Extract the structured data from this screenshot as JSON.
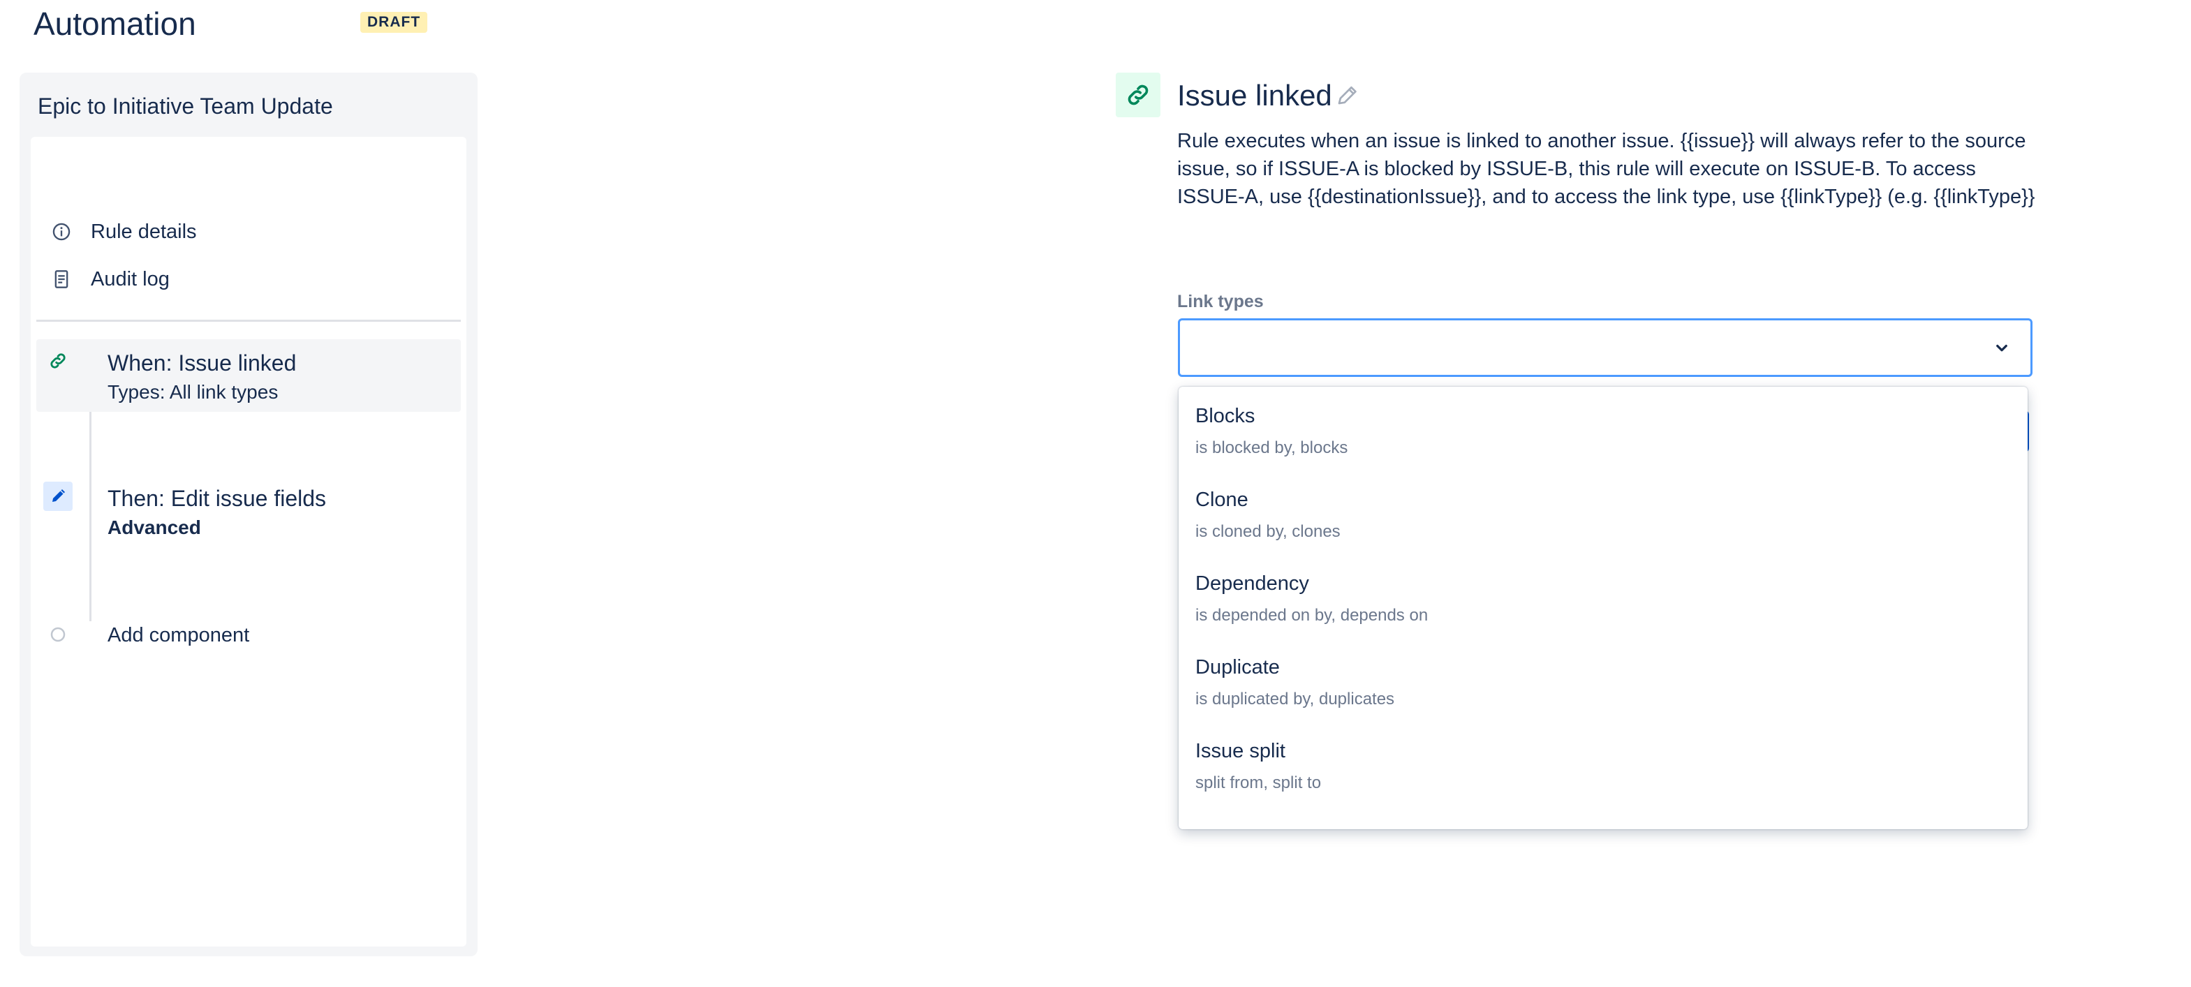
{
  "header": {
    "title": "Automation",
    "badge": "DRAFT"
  },
  "sidebar": {
    "rule_name": "Epic to Initiative Team Update",
    "menu": [
      {
        "label": "Rule details",
        "icon": "info-icon"
      },
      {
        "label": "Audit log",
        "icon": "document-icon"
      }
    ],
    "steps": [
      {
        "title": "When: Issue linked",
        "subtitle": "Types: All link types",
        "icon": "link-icon"
      },
      {
        "title": "Then: Edit issue fields",
        "subtitle": "Advanced",
        "icon": "pencil-icon"
      },
      {
        "title": "Add component",
        "icon": "circle-icon"
      }
    ]
  },
  "main": {
    "title": "Issue linked",
    "description": "Rule executes when an issue is linked to another issue. {{issue}} will always refer to the source issue, so if ISSUE-A is blocked by ISSUE-B, this rule will execute on ISSUE-B. To access ISSUE-A, use {{destinationIssue}}, and to access the link type, use {{linkType}} (e.g. {{linkType}}",
    "field_label": "Link types",
    "select_value": "",
    "options": [
      {
        "title": "Blocks",
        "desc": "is blocked by, blocks"
      },
      {
        "title": "Clone",
        "desc": "is cloned by, clones"
      },
      {
        "title": "Dependency",
        "desc": "is depended on by, depends on"
      },
      {
        "title": "Duplicate",
        "desc": "is duplicated by, duplicates"
      },
      {
        "title": "Issue split",
        "desc": "split from, split to"
      }
    ]
  },
  "colors": {
    "text": "#172b4d",
    "subtle_text": "#6b778c",
    "focus_border": "#4c9aff",
    "link_green": "#00875a",
    "trigger_bg": "#e3fcef",
    "action_blue": "#0052cc",
    "action_bg": "#deebff",
    "badge_bg": "#fff0b3"
  }
}
